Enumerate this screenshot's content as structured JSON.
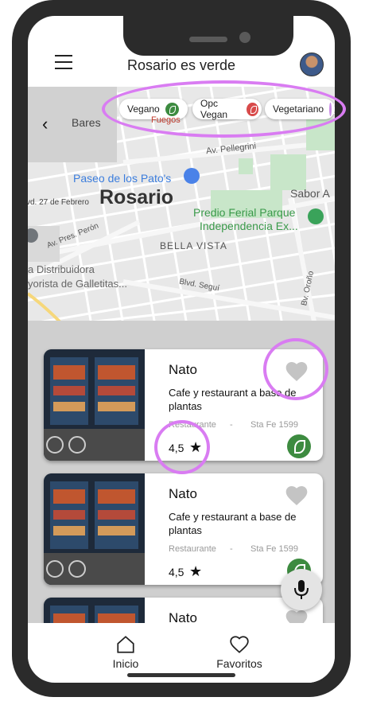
{
  "header": {
    "title": "Rosario es verde"
  },
  "map": {
    "back_label": "Bares",
    "filters": [
      {
        "label": "Vegano",
        "color": "#3d8b40"
      },
      {
        "label": "Opc Vegan",
        "color": "#d84a4a"
      },
      {
        "label": "Vegetariano",
        "color": "#c98ce6"
      }
    ],
    "labels": {
      "city": "Rosario",
      "paseo": "Paseo de los Pato's",
      "pellegrini": "Av. Pellegrini",
      "sabor": "Sabor A",
      "predio": "Predio Ferial Parque",
      "independencia": "Independencia Ex...",
      "febrero": "vd. 27 de Febrero",
      "peron": "Av. Pres. Perón",
      "bella_vista": "BELLA VISTA",
      "distribuidora": "a Distribuidora",
      "galletitas": "yorista de Galletitas...",
      "segui": "Blvd. Seguí",
      "orono": "Bv. Oroño",
      "fuegos": "Fuegos"
    }
  },
  "restaurants": [
    {
      "name": "Nato",
      "description": "Cafe y restaurant a base de plantas",
      "type": "Restaurante",
      "separator": "-",
      "address": "Sta Fe 1599",
      "rating": "4,5"
    },
    {
      "name": "Nato",
      "description": "Cafe y restaurant a base de plantas",
      "type": "Restaurante",
      "separator": "-",
      "address": "Sta Fe 1599",
      "rating": "4,5"
    },
    {
      "name": "Nato"
    }
  ],
  "nav": {
    "home_label": "Inicio",
    "favorites_label": "Favoritos"
  },
  "colors": {
    "highlight": "#d97cf2",
    "vegan_green": "#3d8b40",
    "frame": "#2b2b2b"
  }
}
